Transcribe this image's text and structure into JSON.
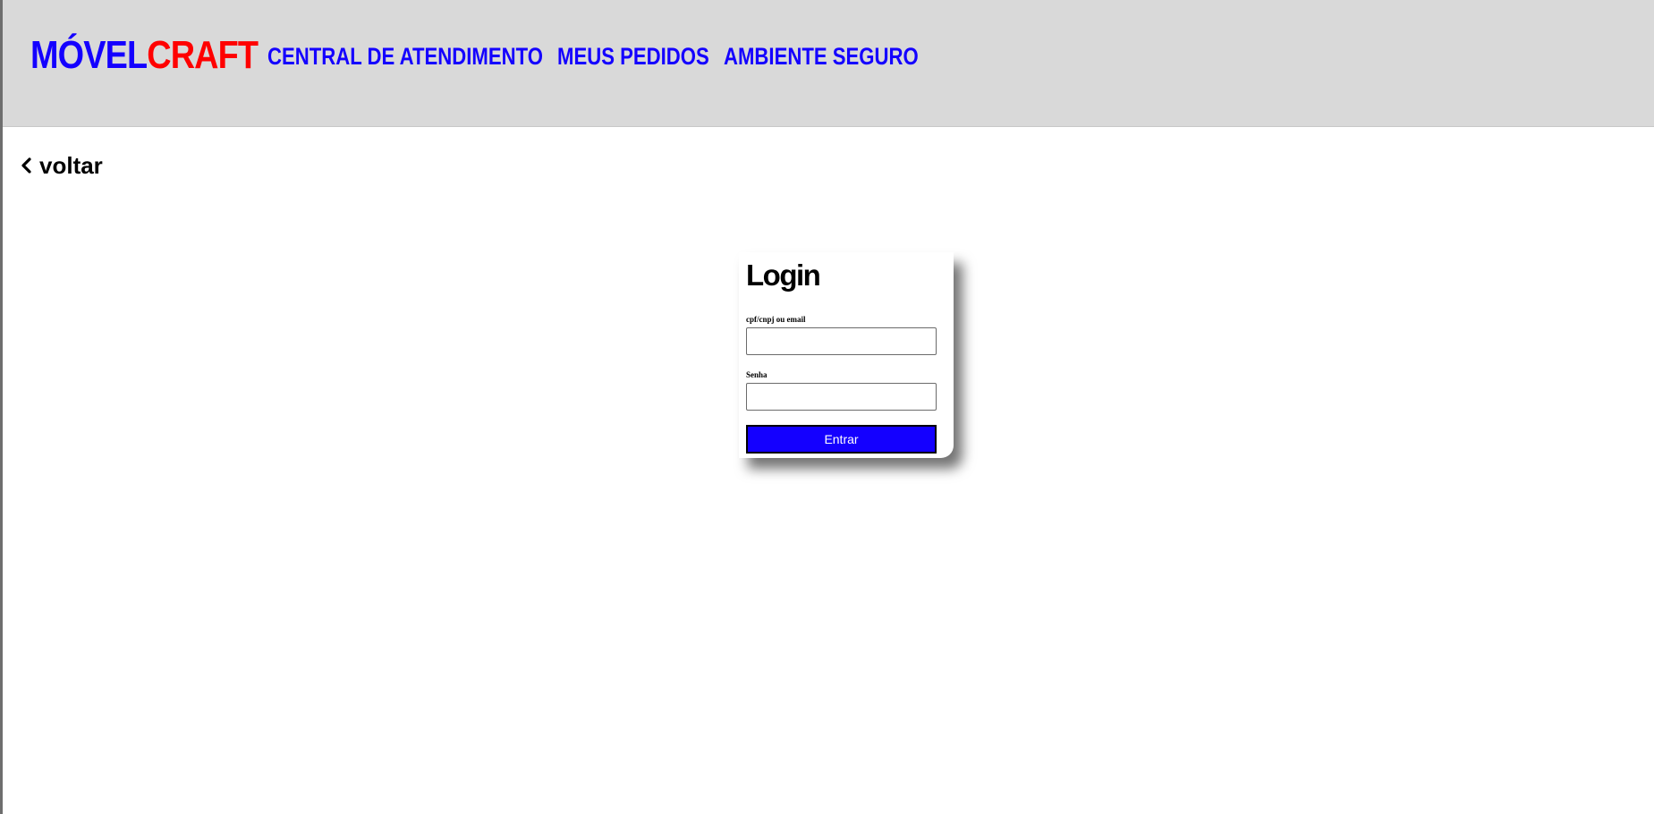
{
  "header": {
    "logo": {
      "part_a": "MÓVEL",
      "part_b": "CRAFT"
    },
    "nav": [
      {
        "label": "CENTRAL DE ATENDIMENTO"
      },
      {
        "label": "MEUS PEDIDOS"
      },
      {
        "label": "AMBIENTE SEGURO"
      }
    ]
  },
  "back": {
    "label": "voltar",
    "icon": "chevron-left-icon"
  },
  "login": {
    "title": "Login",
    "fields": [
      {
        "label": "cpf/cnpj ou email",
        "value": "",
        "placeholder": ""
      },
      {
        "label": "Senha",
        "value": "",
        "placeholder": ""
      }
    ],
    "submit_label": "Entrar"
  },
  "colors": {
    "brand_blue": "#1400ff",
    "brand_red": "#ff0000",
    "header_bg": "#d9d9d9"
  }
}
